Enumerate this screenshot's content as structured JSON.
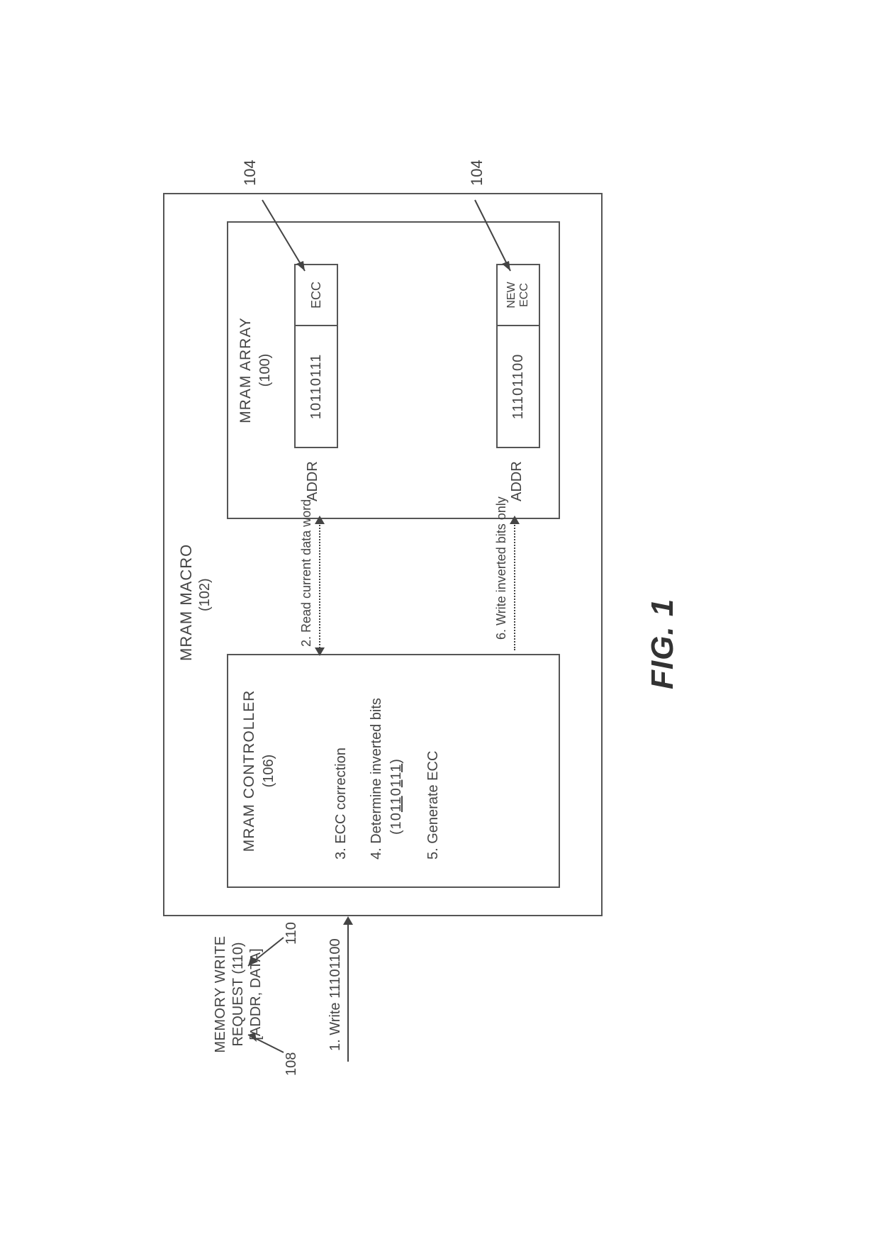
{
  "figure_label": "FIG. 1",
  "macro": {
    "title": "MRAM MACRO",
    "num": "(102)"
  },
  "controller": {
    "title": "MRAM CONTROLLER",
    "num": "(106)",
    "step3": "3. ECC correction",
    "step4": "4. Determine inverted bits",
    "bits4_pre": "(10",
    "bits4_u1": "11",
    "bits4_mid1": "0",
    "bits4_u2": "1",
    "bits4_mid2": "1",
    "bits4_u3": "1",
    "bits4_post": ")",
    "step5": "5. Generate ECC"
  },
  "array": {
    "title": "MRAM ARRAY",
    "num": "(100)"
  },
  "word1": {
    "addr": "ADDR",
    "data": "10110111",
    "ecc": "ECC",
    "ref": "104"
  },
  "word2": {
    "addr": "ADDR",
    "data": "11101100",
    "ecc_l1": "NEW",
    "ecc_l2": "ECC",
    "ref": "104"
  },
  "step2_label": "2. Read current data word",
  "step6_label": "6. Write inverted bits only",
  "request": {
    "line1": "MEMORY WRITE",
    "line2": "REQUEST (110)",
    "line3": "[ADDR, DATA]",
    "ref108": "108",
    "ref110": "110"
  },
  "step1_label": "1. Write 11101100"
}
